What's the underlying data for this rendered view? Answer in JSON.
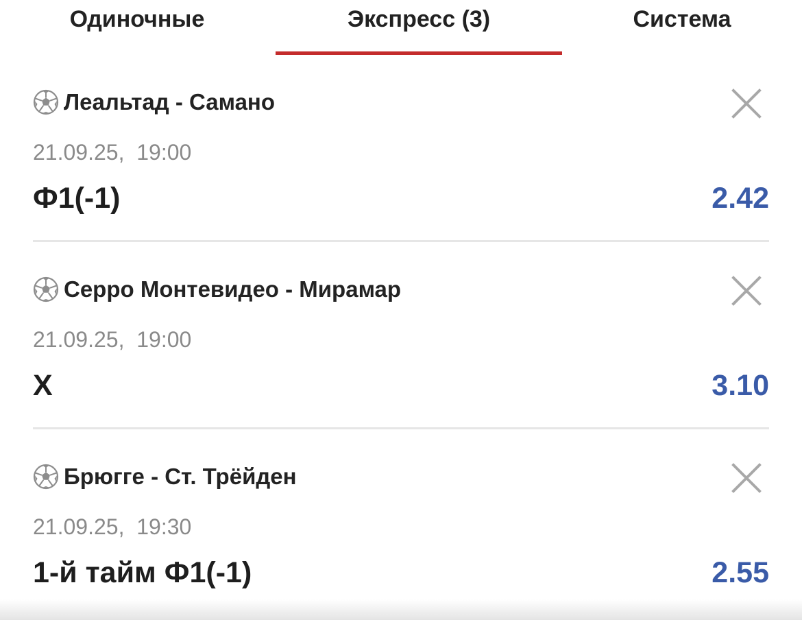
{
  "tabs": [
    {
      "label": "Одиночные",
      "active": false
    },
    {
      "label": "Экспресс (3)",
      "active": true
    },
    {
      "label": "Система",
      "active": false
    }
  ],
  "colors": {
    "accent_red": "#c42c2c",
    "odds_blue": "#3a5ba8",
    "text_dark": "#232323",
    "text_muted": "#8a8a8a",
    "divider": "#e6e6e6"
  },
  "bets": [
    {
      "sport_icon": "soccer-ball-icon",
      "match": "Леальтад - Самано",
      "datetime": "21.09.25,  19:00",
      "outcome": "Ф1(-1)",
      "odds": "2.42"
    },
    {
      "sport_icon": "soccer-ball-icon",
      "match": "Серро Монтевидео - Мирамар",
      "datetime": "21.09.25,  19:00",
      "outcome": "Х",
      "odds": "3.10"
    },
    {
      "sport_icon": "soccer-ball-icon",
      "match": "Брюгге - Ст. Трёйден",
      "datetime": "21.09.25,  19:30",
      "outcome": "1-й тайм Ф1(-1)",
      "odds": "2.55"
    }
  ]
}
